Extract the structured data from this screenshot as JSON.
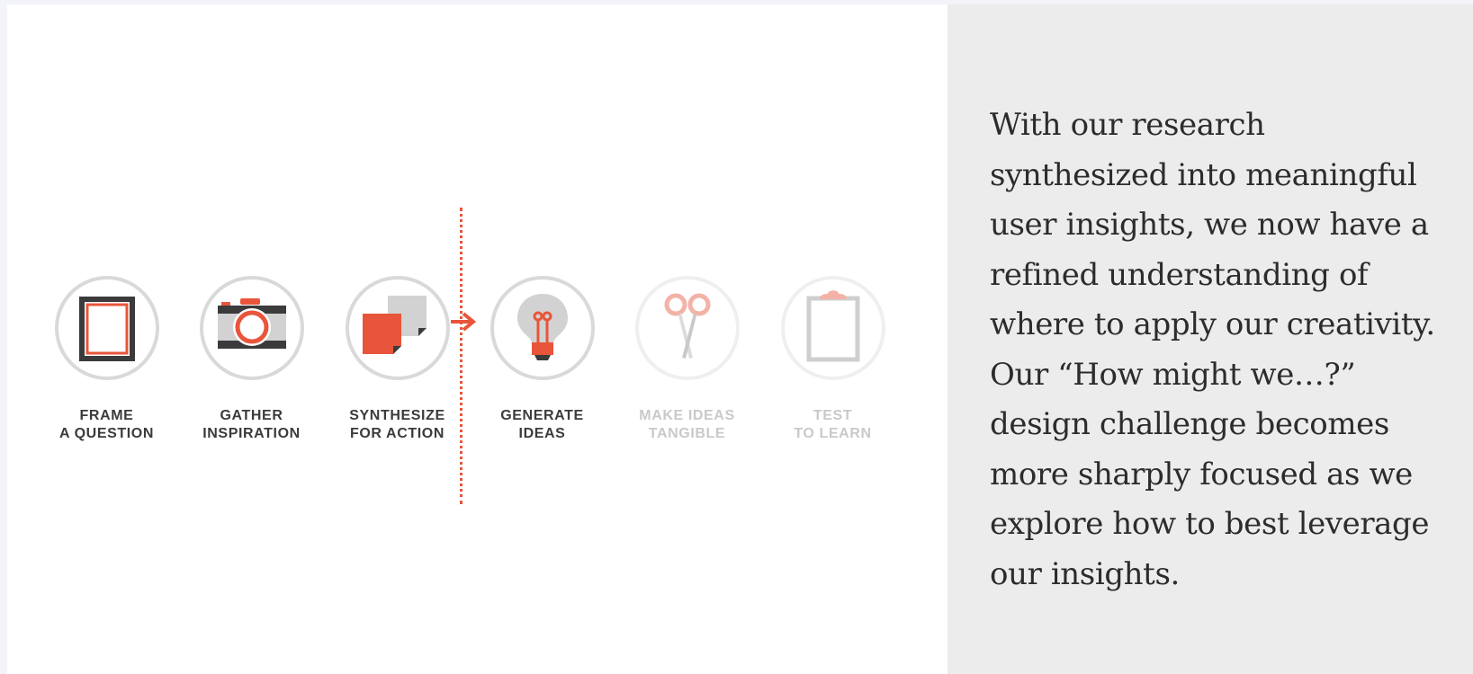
{
  "steps": [
    {
      "line1": "FRAME",
      "line2": "A QUESTION",
      "icon": "frame-icon",
      "active": true
    },
    {
      "line1": "GATHER",
      "line2": "INSPIRATION",
      "icon": "camera-icon",
      "active": true
    },
    {
      "line1": "SYNTHESIZE",
      "line2": "FOR ACTION",
      "icon": "sticky-notes-icon",
      "active": true
    },
    {
      "line1": "GENERATE",
      "line2": "IDEAS",
      "icon": "lightbulb-icon",
      "active": true
    },
    {
      "line1": "MAKE IDEAS",
      "line2": "TANGIBLE",
      "icon": "scissors-icon",
      "active": false
    },
    {
      "line1": "TEST",
      "line2": "TO LEARN",
      "icon": "clipboard-icon",
      "active": false
    }
  ],
  "panel": {
    "text": "With our research synthesized into meaningful user insights, we now have a refined understanding of where to apply our creativity. Our “How might we…?” design challenge becomes more sharply focused as we explore how to best leverage our insights."
  },
  "colors": {
    "accent": "#e8553a",
    "dark": "#3b3b3b",
    "ring": "#d9d9d9",
    "dim": "#c9c9c9",
    "panel_bg": "#ececec"
  }
}
